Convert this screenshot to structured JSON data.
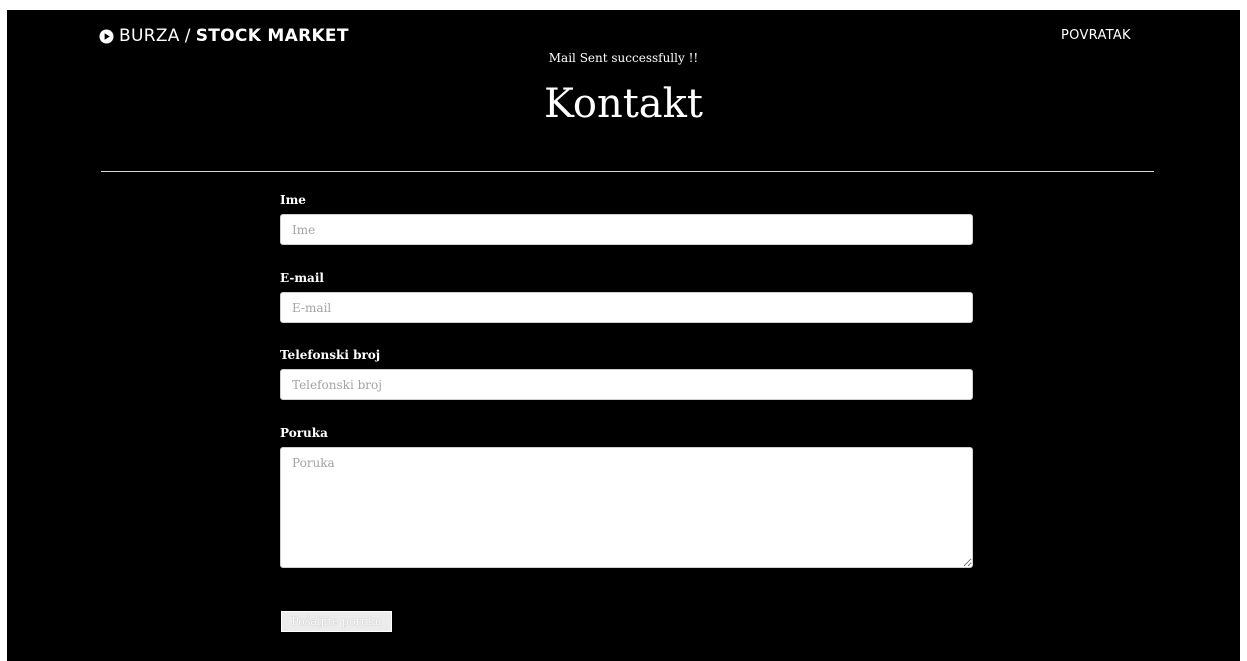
{
  "header": {
    "brand_part1": "BURZA",
    "brand_separator": "/",
    "brand_part2": "STOCK MARKET",
    "brand_icon": "play-circle-icon",
    "nav_back_label": "POVRATAK"
  },
  "status_message": "Mail Sent successfully !!",
  "page_title": "Kontakt",
  "form": {
    "name": {
      "label": "Ime",
      "placeholder": "Ime",
      "value": ""
    },
    "email": {
      "label": "E-mail",
      "placeholder": "E-mail",
      "value": ""
    },
    "phone": {
      "label": "Telefonski broj",
      "placeholder": "Telefonski broj",
      "value": ""
    },
    "message": {
      "label": "Poruka",
      "placeholder": "Poruka",
      "value": ""
    },
    "submit_label": "Pošaljite poruku"
  },
  "colors": {
    "background": "#000000",
    "text": "#ffffff",
    "input_background": "#ffffff",
    "placeholder": "#a4a4a4",
    "button_background": "#ececec"
  }
}
